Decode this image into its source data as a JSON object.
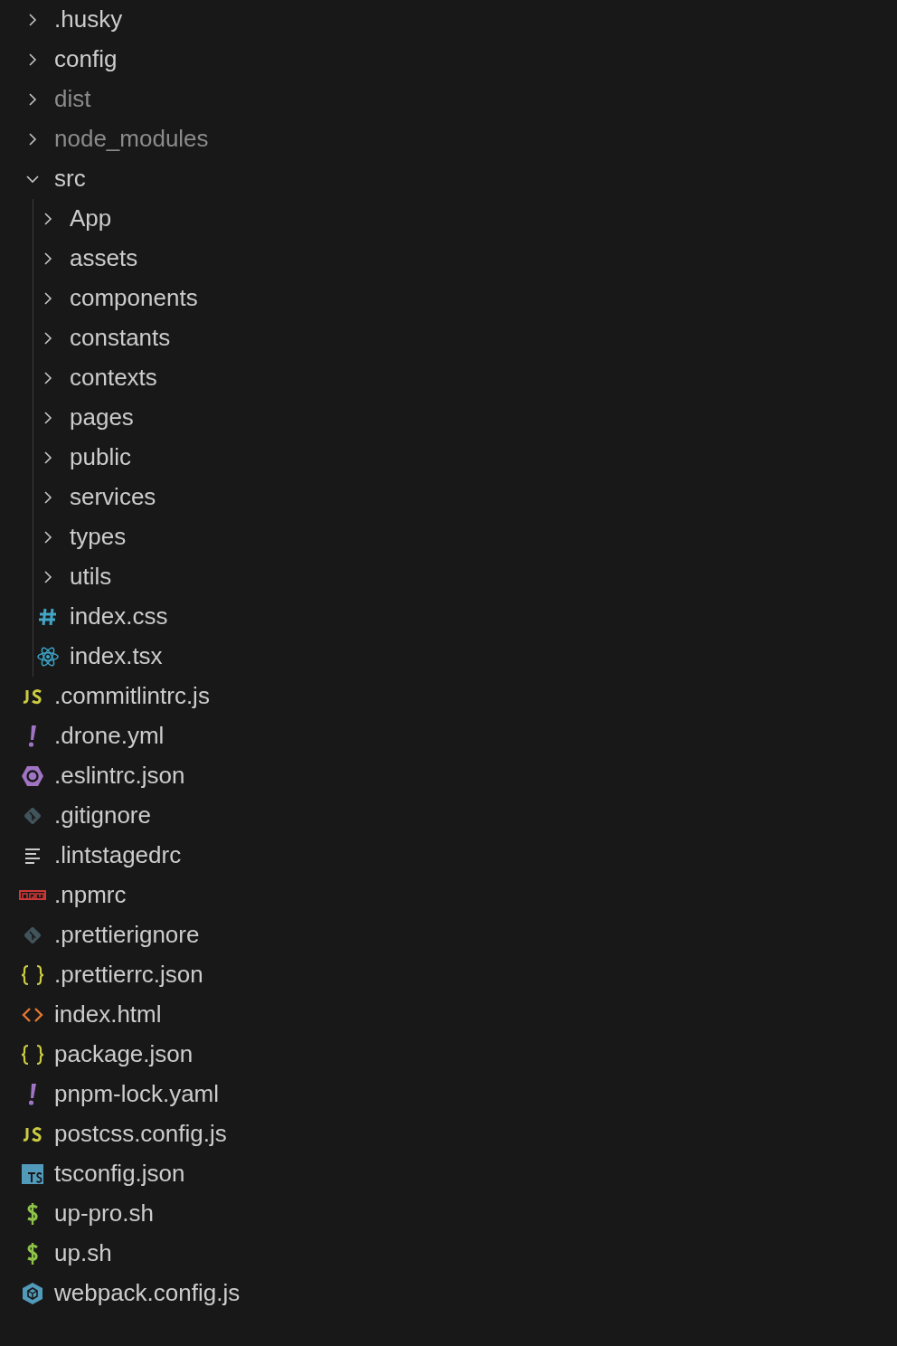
{
  "explorer": {
    "items": [
      {
        "kind": "folder",
        "label": ".husky",
        "expanded": false,
        "ignored": false
      },
      {
        "kind": "folder",
        "label": "config",
        "expanded": false,
        "ignored": false
      },
      {
        "kind": "folder",
        "label": "dist",
        "expanded": false,
        "ignored": true
      },
      {
        "kind": "folder",
        "label": "node_modules",
        "expanded": false,
        "ignored": true
      },
      {
        "kind": "folder",
        "label": "src",
        "expanded": true,
        "ignored": false,
        "children": [
          {
            "kind": "folder",
            "label": "App",
            "expanded": false,
            "ignored": false
          },
          {
            "kind": "folder",
            "label": "assets",
            "expanded": false,
            "ignored": false
          },
          {
            "kind": "folder",
            "label": "components",
            "expanded": false,
            "ignored": false
          },
          {
            "kind": "folder",
            "label": "constants",
            "expanded": false,
            "ignored": false
          },
          {
            "kind": "folder",
            "label": "contexts",
            "expanded": false,
            "ignored": false
          },
          {
            "kind": "folder",
            "label": "pages",
            "expanded": false,
            "ignored": false
          },
          {
            "kind": "folder",
            "label": "public",
            "expanded": false,
            "ignored": false
          },
          {
            "kind": "folder",
            "label": "services",
            "expanded": false,
            "ignored": false
          },
          {
            "kind": "folder",
            "label": "types",
            "expanded": false,
            "ignored": false
          },
          {
            "kind": "folder",
            "label": "utils",
            "expanded": false,
            "ignored": false
          },
          {
            "kind": "css",
            "label": "index.css"
          },
          {
            "kind": "react",
            "label": "index.tsx"
          }
        ]
      },
      {
        "kind": "js",
        "label": ".commitlintrc.js"
      },
      {
        "kind": "yaml",
        "label": ".drone.yml"
      },
      {
        "kind": "eslint",
        "label": ".eslintrc.json"
      },
      {
        "kind": "git",
        "label": ".gitignore"
      },
      {
        "kind": "text",
        "label": ".lintstagedrc"
      },
      {
        "kind": "npm",
        "label": ".npmrc"
      },
      {
        "kind": "git",
        "label": ".prettierignore"
      },
      {
        "kind": "json",
        "label": ".prettierrc.json"
      },
      {
        "kind": "html",
        "label": "index.html"
      },
      {
        "kind": "json",
        "label": "package.json"
      },
      {
        "kind": "yaml",
        "label": "pnpm-lock.yaml"
      },
      {
        "kind": "js",
        "label": "postcss.config.js"
      },
      {
        "kind": "ts",
        "label": "tsconfig.json"
      },
      {
        "kind": "shell",
        "label": "up-pro.sh"
      },
      {
        "kind": "shell",
        "label": "up.sh"
      },
      {
        "kind": "webpack",
        "label": "webpack.config.js"
      }
    ]
  }
}
